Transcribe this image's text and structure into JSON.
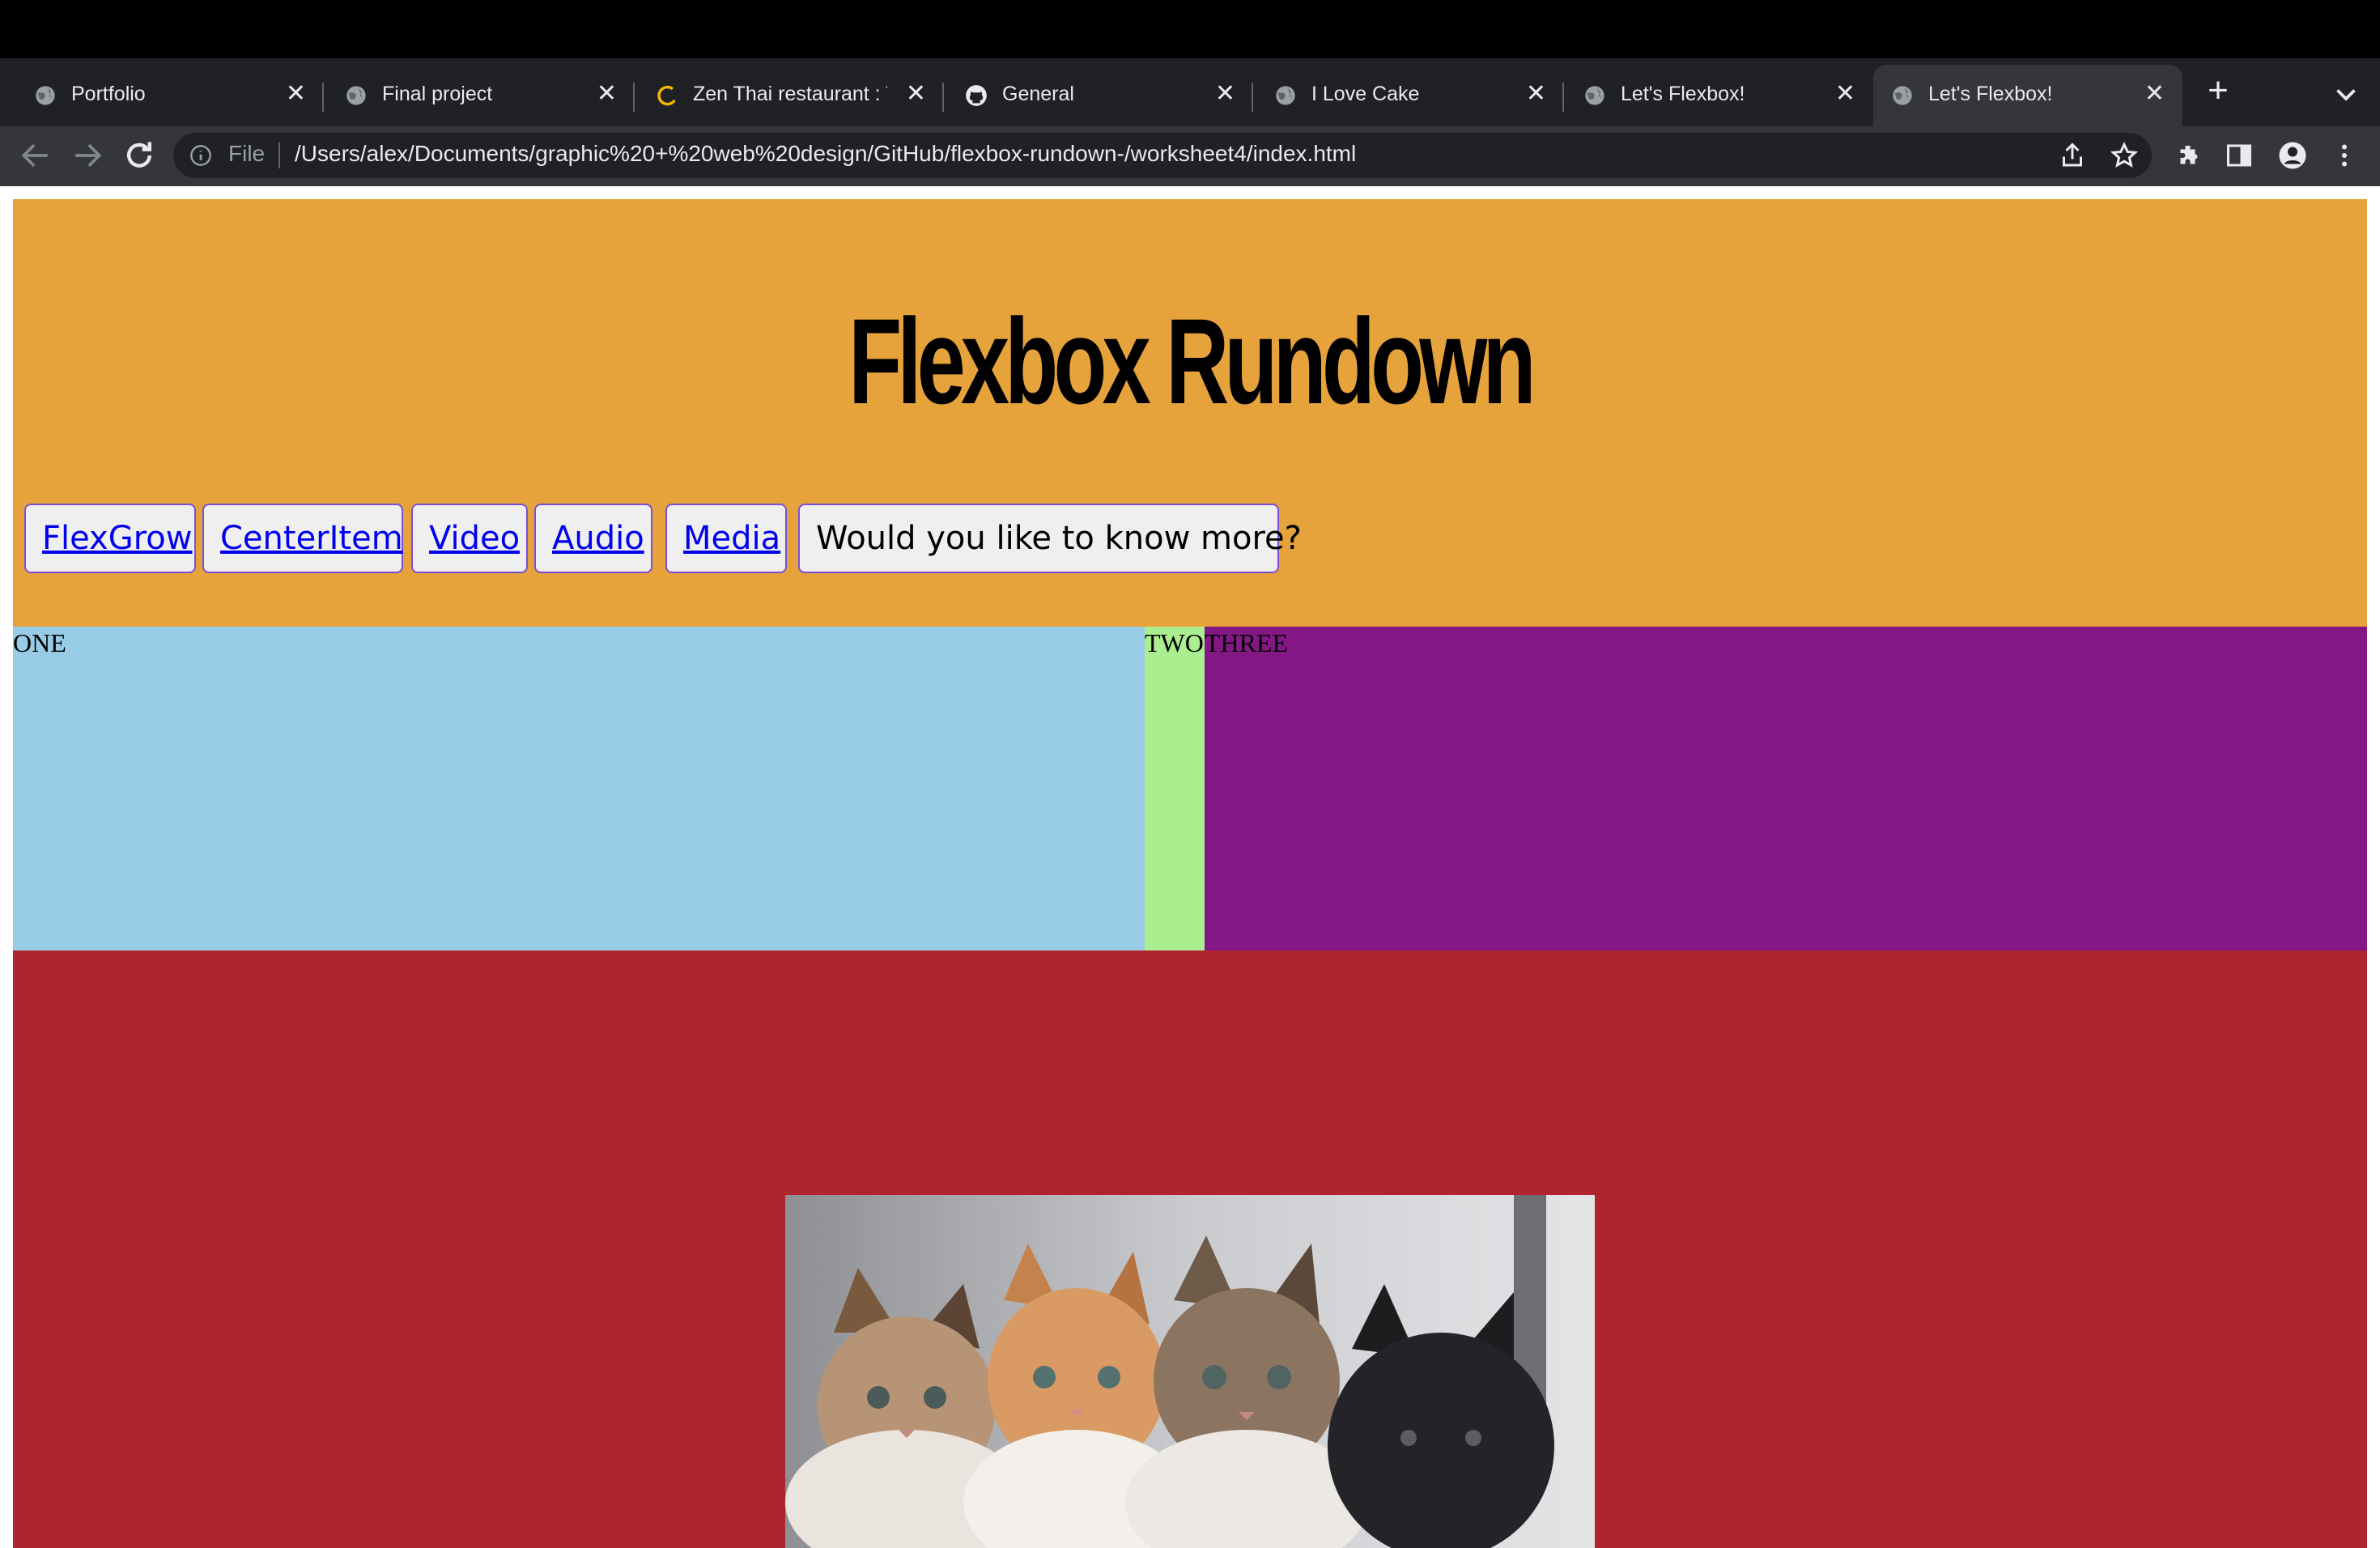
{
  "browser": {
    "tabs": [
      {
        "title": "Portfolio",
        "icon": "globe-icon",
        "active": false
      },
      {
        "title": "Final project",
        "icon": "globe-icon",
        "active": false
      },
      {
        "title": "Zen Thai restaurant : T",
        "icon": "loading-icon",
        "active": false
      },
      {
        "title": "General",
        "icon": "github-icon",
        "active": false
      },
      {
        "title": "I Love Cake",
        "icon": "globe-icon",
        "active": false
      },
      {
        "title": "Let's Flexbox!",
        "icon": "globe-icon",
        "active": false
      },
      {
        "title": "Let's Flexbox!",
        "icon": "globe-icon",
        "active": true
      }
    ],
    "omnibox": {
      "scheme_label": "File",
      "url": "/Users/alex/Documents/graphic%20+%20web%20design/GitHub/flexbox-rundown-/worksheet4/index.html"
    }
  },
  "page": {
    "title": "Flexbox Rundown",
    "nav": [
      {
        "label": "FlexGrow",
        "link": true
      },
      {
        "label": "CenterItem",
        "link": true
      },
      {
        "label": "Video",
        "link": true
      },
      {
        "label": "Audio",
        "link": true
      },
      {
        "label": "Media",
        "link": true
      },
      {
        "label": "Would you like to know more?",
        "link": false
      }
    ],
    "boxes": {
      "one": "ONE",
      "two": "TWO",
      "three": "THREE"
    },
    "colors": {
      "header": "#e6a23b",
      "box_one": "#98cbe6",
      "box_two": "#aaee8f",
      "box_three": "#831885",
      "media_section": "#b0242d"
    }
  }
}
